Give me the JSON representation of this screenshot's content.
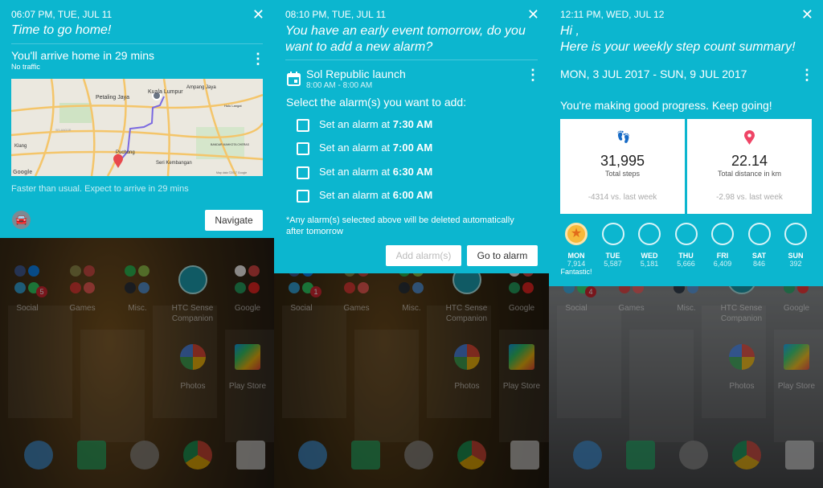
{
  "colors": {
    "card": "#0cb6cf",
    "steps_icon": "#10b981",
    "distance_icon": "#ef4566",
    "star": "#f6b93b"
  },
  "travel_card": {
    "time": "06:07 PM, TUE, JUL 11",
    "title": "Time to go home!",
    "headline": "You'll arrive home in 29 mins",
    "subline": "No traffic",
    "map": {
      "labels": [
        "Petaling Jaya",
        "Kuala Lumpur",
        "Ampang Jaya",
        "Hulu Langat",
        "Klang",
        "Puchong",
        "Seri Kembangan",
        "BANDAR MAHKOTA CHERAS",
        "SELANGOR"
      ],
      "logo": "Google",
      "attribution": "Map data ©2017 Google"
    },
    "note": "Faster than usual. Expect to arrive in 29 mins",
    "mode_icon": "car-icon",
    "navigate_label": "Navigate"
  },
  "alarm_card": {
    "time": "08:10 PM, TUE, JUL 11",
    "title_line1": "You have an early event tomorrow, do you",
    "title_line2": "want to add a new alarm?",
    "event_name": "Sol Republic launch",
    "event_time": "8:00 AM - 8:00 AM",
    "prompt": "Select the alarm(s) you want to add:",
    "options": [
      {
        "prefix": "Set an alarm at ",
        "time": "7:30 AM",
        "checked": false
      },
      {
        "prefix": "Set an alarm at ",
        "time": "7:00 AM",
        "checked": false
      },
      {
        "prefix": "Set an alarm at ",
        "time": "6:30 AM",
        "checked": false
      },
      {
        "prefix": "Set an alarm at ",
        "time": "6:00 AM",
        "checked": false
      }
    ],
    "footnote_line1": "*Any alarm(s) selected above will be deleted automatically",
    "footnote_line2": "after tomorrow",
    "add_label": "Add alarm(s)",
    "goto_label": "Go to alarm"
  },
  "steps_card": {
    "time": "12:11 PM, WED, JUL 12",
    "greeting": "Hi ,",
    "title": "Here is your weekly step count summary!",
    "range": "MON, 3 JUL 2017 - SUN, 9 JUL 2017",
    "message": "You're making good progress. Keep going!",
    "steps": {
      "value": "31,995",
      "label": "Total steps",
      "compare": "-4314 vs. last week"
    },
    "distance": {
      "value": "22.14",
      "label": "Total distance in km",
      "compare": "-2.98 vs. last week"
    },
    "days": [
      {
        "day": "MON",
        "steps": "7,914",
        "note": "Fantastic!",
        "goal_met": true
      },
      {
        "day": "TUE",
        "steps": "5,587"
      },
      {
        "day": "WED",
        "steps": "5,181"
      },
      {
        "day": "THU",
        "steps": "5,666"
      },
      {
        "day": "FRI",
        "steps": "6,409"
      },
      {
        "day": "SAT",
        "steps": "846"
      },
      {
        "day": "SUN",
        "steps": "392"
      }
    ]
  },
  "home_screens": [
    {
      "folders": [
        "Social",
        "Games",
        "Misc.",
        "HTC Sense Companion",
        "Google"
      ],
      "apps": [
        "Photos",
        "Play Store"
      ],
      "social_badge": "5"
    },
    {
      "folders": [
        "Social",
        "Games",
        "Misc.",
        "HTC Sense Companion",
        "Google"
      ],
      "apps": [
        "Photos",
        "Play Store"
      ],
      "social_badge": "1"
    },
    {
      "folders": [
        "Social",
        "Games",
        "Misc.",
        "HTC Sense Companion",
        "Google"
      ],
      "apps": [
        "Photos",
        "Play Store"
      ],
      "social_badge": "4"
    }
  ]
}
